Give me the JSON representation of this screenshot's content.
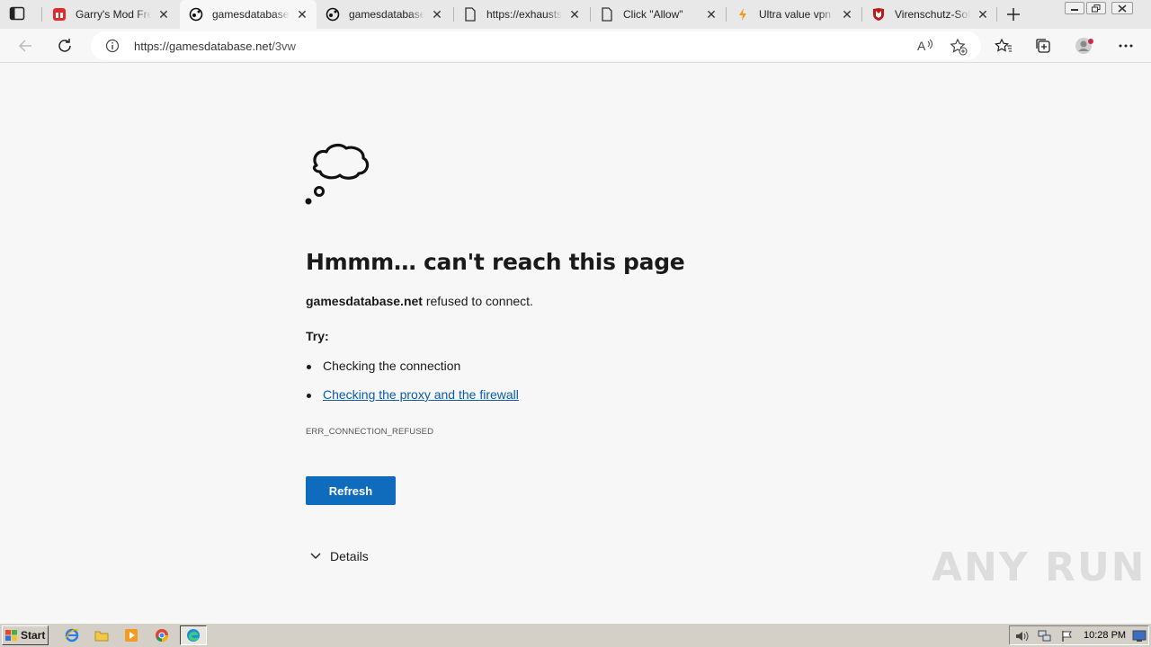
{
  "tabs": [
    {
      "title": "Garry's Mod Free",
      "icon": "red-gift-icon"
    },
    {
      "title": "gamesdatabase.net",
      "icon": "games-icon",
      "active": true
    },
    {
      "title": "gamesdatabase.net",
      "icon": "games-icon"
    },
    {
      "title": "https://exhausts",
      "icon": "page-icon"
    },
    {
      "title": "Click \"Allow\"",
      "icon": "page-icon"
    },
    {
      "title": "Ultra value vpn",
      "icon": "bolt-icon"
    },
    {
      "title": "Virenschutz-Soft",
      "icon": "mcafee-shield-icon"
    }
  ],
  "address_bar": {
    "url_host": "https://gamesdatabase.net",
    "url_path": "/3vw"
  },
  "error_page": {
    "heading": "Hmmm… can't reach this page",
    "host": "gamesdatabase.net",
    "message_tail": " refused to connect.",
    "try_label": "Try:",
    "suggestions": [
      "Checking the connection",
      "Checking the proxy and the firewall"
    ],
    "error_code": "ERR_CONNECTION_REFUSED",
    "refresh_label": "Refresh",
    "details_label": "Details"
  },
  "watermark": "ANY RUN",
  "taskbar": {
    "start_label": "Start",
    "clock": "10:28 PM"
  },
  "colors": {
    "accent": "#0f6cbd",
    "link": "#0b5cad",
    "page_bg": "#f7f7f7"
  }
}
